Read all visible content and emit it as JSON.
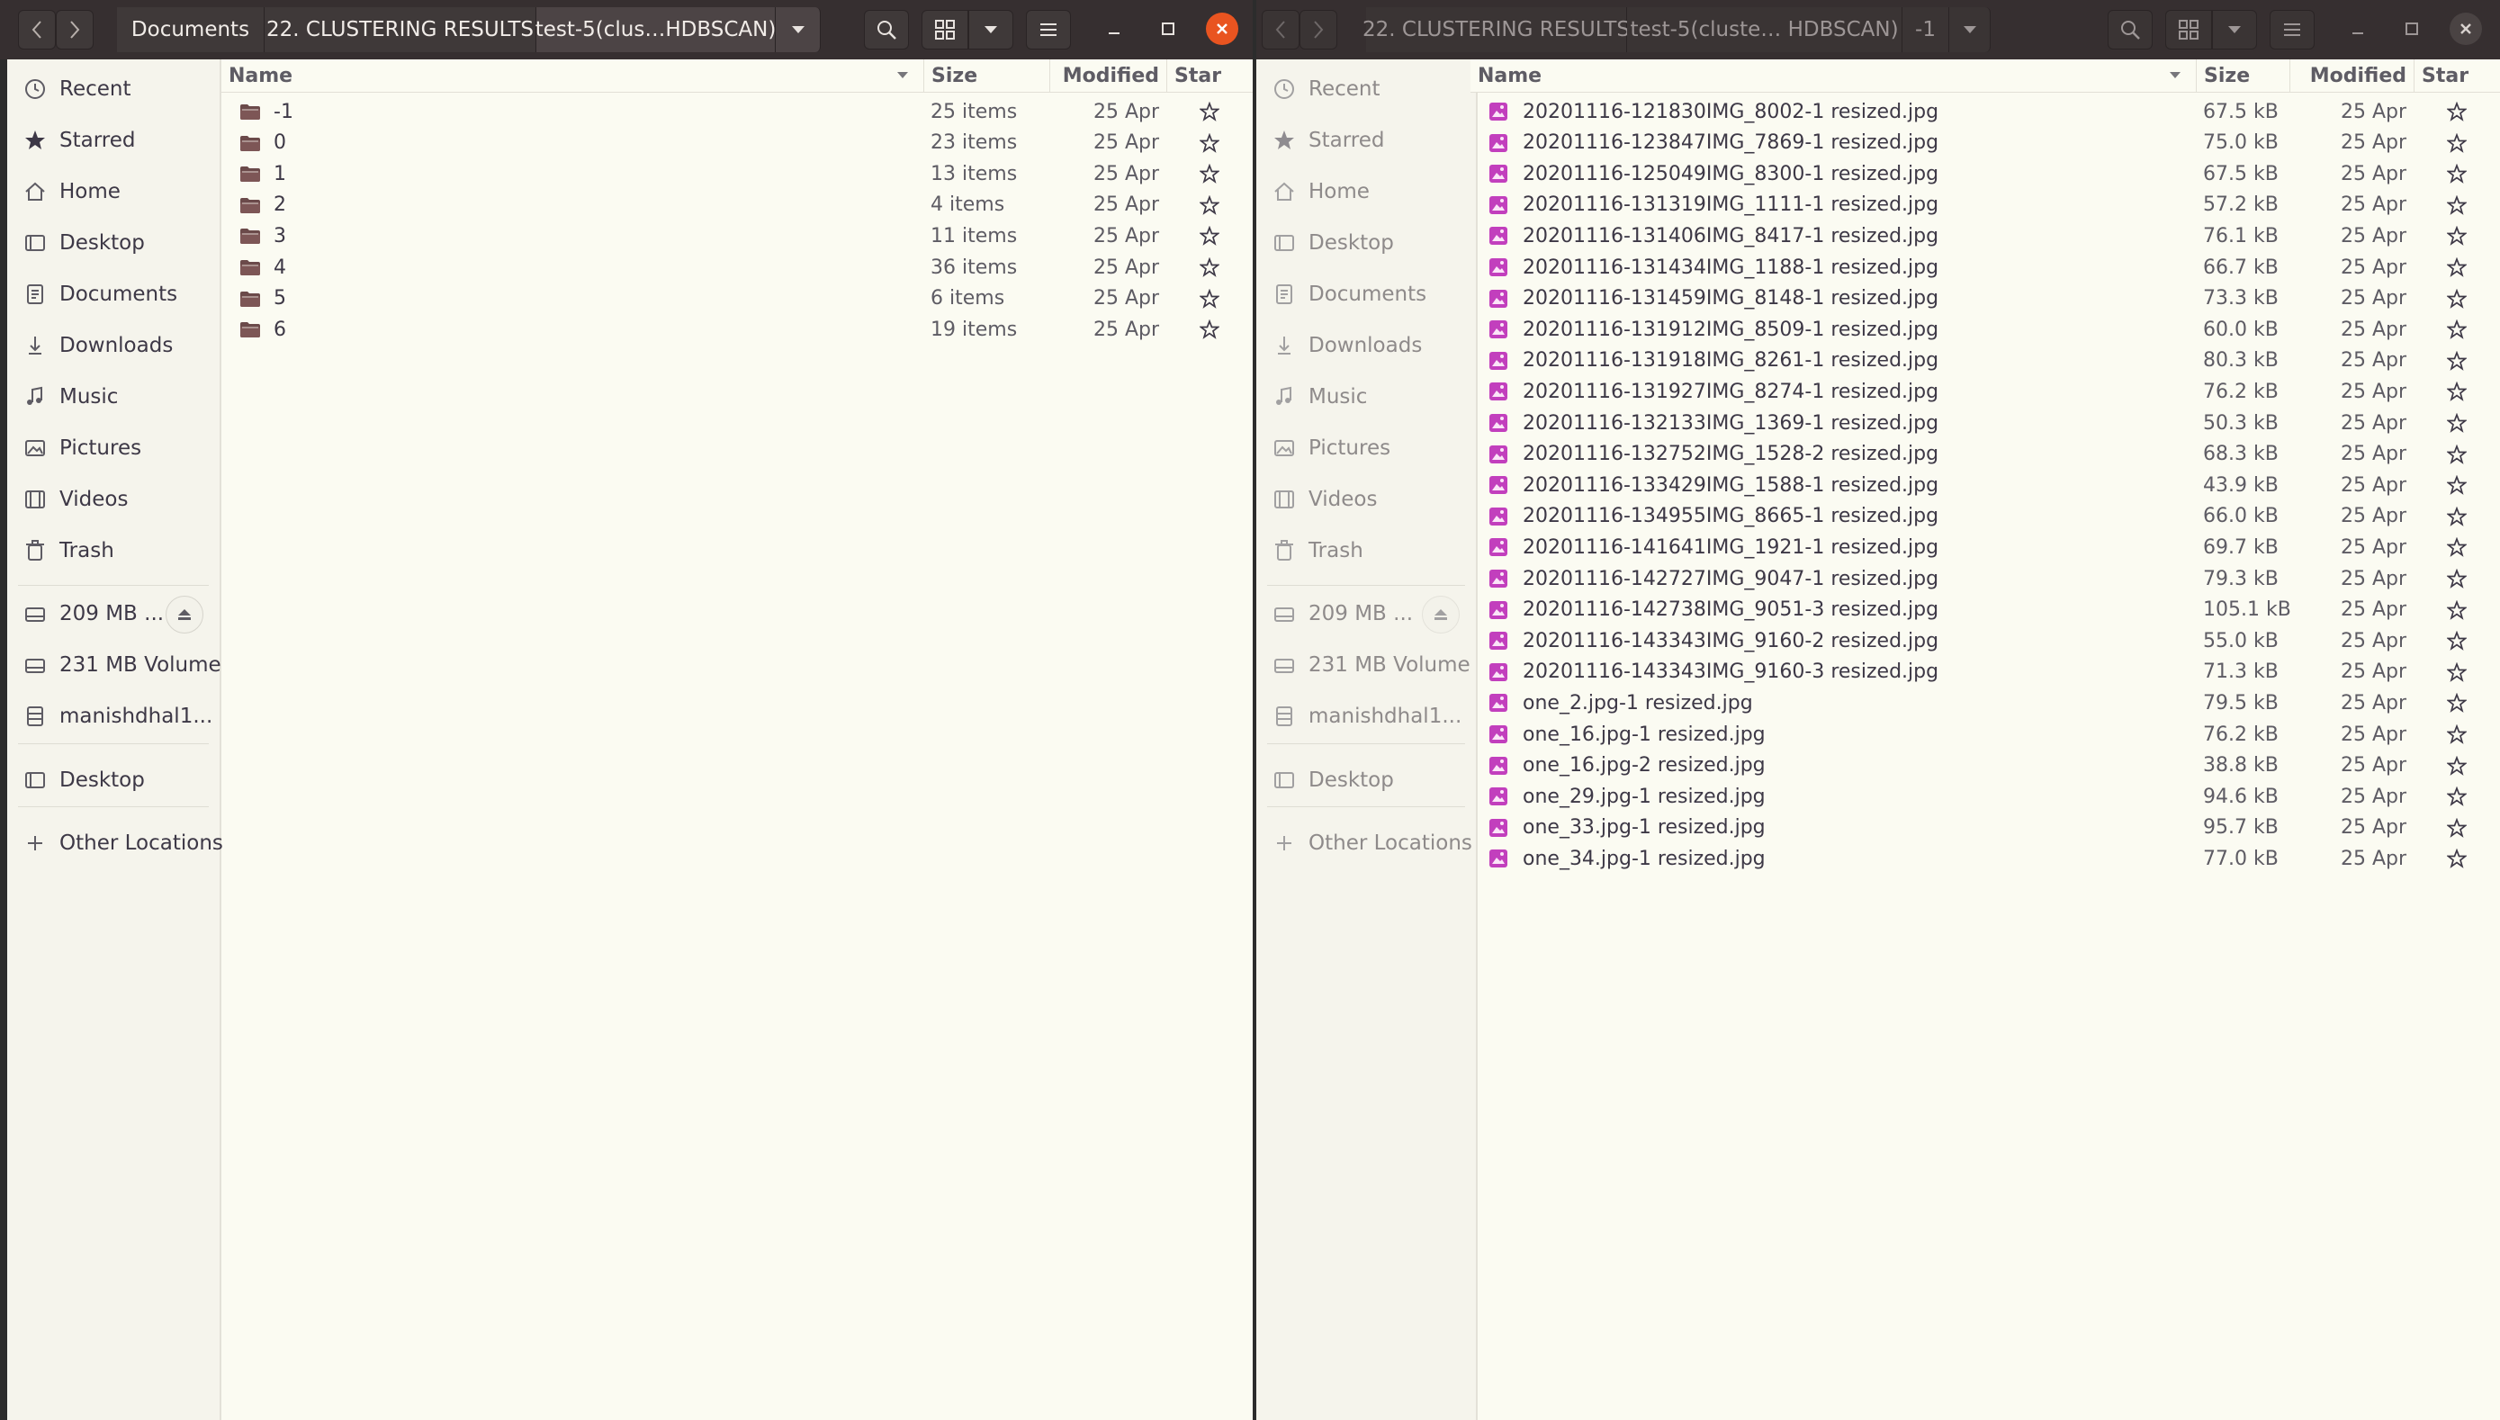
{
  "left": {
    "breadcrumbs": [
      "Documents",
      "22. CLUSTERING RESULTS",
      "test-5(clus…HDBSCAN)"
    ],
    "columns": {
      "name": "Name",
      "size": "Size",
      "modified": "Modified",
      "star": "Star"
    },
    "rows": [
      {
        "name": "-1",
        "size": "25 items",
        "modified": "25 Apr"
      },
      {
        "name": "0",
        "size": "23 items",
        "modified": "25 Apr"
      },
      {
        "name": "1",
        "size": "13 items",
        "modified": "25 Apr"
      },
      {
        "name": "2",
        "size": "4 items",
        "modified": "25 Apr"
      },
      {
        "name": "3",
        "size": "11 items",
        "modified": "25 Apr"
      },
      {
        "name": "4",
        "size": "36 items",
        "modified": "25 Apr"
      },
      {
        "name": "5",
        "size": "6 items",
        "modified": "25 Apr"
      },
      {
        "name": "6",
        "size": "19 items",
        "modified": "25 Apr"
      }
    ]
  },
  "right": {
    "breadcrumbs": [
      "22. CLUSTERING RESULTS",
      "test-5(cluste… HDBSCAN)",
      "-1"
    ],
    "columns": {
      "name": "Name",
      "size": "Size",
      "modified": "Modified",
      "star": "Star"
    },
    "rows": [
      {
        "name": "20201116-121830IMG_8002-1 resized.jpg",
        "size": "67.5 kB",
        "modified": "25 Apr"
      },
      {
        "name": "20201116-123847IMG_7869-1 resized.jpg",
        "size": "75.0 kB",
        "modified": "25 Apr"
      },
      {
        "name": "20201116-125049IMG_8300-1 resized.jpg",
        "size": "67.5 kB",
        "modified": "25 Apr"
      },
      {
        "name": "20201116-131319IMG_1111-1 resized.jpg",
        "size": "57.2 kB",
        "modified": "25 Apr"
      },
      {
        "name": "20201116-131406IMG_8417-1 resized.jpg",
        "size": "76.1 kB",
        "modified": "25 Apr"
      },
      {
        "name": "20201116-131434IMG_1188-1 resized.jpg",
        "size": "66.7 kB",
        "modified": "25 Apr"
      },
      {
        "name": "20201116-131459IMG_8148-1 resized.jpg",
        "size": "73.3 kB",
        "modified": "25 Apr"
      },
      {
        "name": "20201116-131912IMG_8509-1 resized.jpg",
        "size": "60.0 kB",
        "modified": "25 Apr"
      },
      {
        "name": "20201116-131918IMG_8261-1 resized.jpg",
        "size": "80.3 kB",
        "modified": "25 Apr"
      },
      {
        "name": "20201116-131927IMG_8274-1 resized.jpg",
        "size": "76.2 kB",
        "modified": "25 Apr"
      },
      {
        "name": "20201116-132133IMG_1369-1 resized.jpg",
        "size": "50.3 kB",
        "modified": "25 Apr"
      },
      {
        "name": "20201116-132752IMG_1528-2 resized.jpg",
        "size": "68.3 kB",
        "modified": "25 Apr"
      },
      {
        "name": "20201116-133429IMG_1588-1 resized.jpg",
        "size": "43.9 kB",
        "modified": "25 Apr"
      },
      {
        "name": "20201116-134955IMG_8665-1 resized.jpg",
        "size": "66.0 kB",
        "modified": "25 Apr"
      },
      {
        "name": "20201116-141641IMG_1921-1 resized.jpg",
        "size": "69.7 kB",
        "modified": "25 Apr"
      },
      {
        "name": "20201116-142727IMG_9047-1 resized.jpg",
        "size": "79.3 kB",
        "modified": "25 Apr"
      },
      {
        "name": "20201116-142738IMG_9051-3 resized.jpg",
        "size": "105.1 kB",
        "modified": "25 Apr"
      },
      {
        "name": "20201116-143343IMG_9160-2 resized.jpg",
        "size": "55.0 kB",
        "modified": "25 Apr"
      },
      {
        "name": "20201116-143343IMG_9160-3 resized.jpg",
        "size": "71.3 kB",
        "modified": "25 Apr"
      },
      {
        "name": "one_2.jpg-1 resized.jpg",
        "size": "79.5 kB",
        "modified": "25 Apr"
      },
      {
        "name": "one_16.jpg-1 resized.jpg",
        "size": "76.2 kB",
        "modified": "25 Apr"
      },
      {
        "name": "one_16.jpg-2 resized.jpg",
        "size": "38.8 kB",
        "modified": "25 Apr"
      },
      {
        "name": "one_29.jpg-1 resized.jpg",
        "size": "94.6 kB",
        "modified": "25 Apr"
      },
      {
        "name": "one_33.jpg-1 resized.jpg",
        "size": "95.7 kB",
        "modified": "25 Apr"
      },
      {
        "name": "one_34.jpg-1 resized.jpg",
        "size": "77.0 kB",
        "modified": "25 Apr"
      }
    ]
  },
  "sidebar": {
    "items": [
      {
        "label": "Recent",
        "icon": "clock-icon"
      },
      {
        "label": "Starred",
        "icon": "star-icon"
      },
      {
        "label": "Home",
        "icon": "home-icon"
      },
      {
        "label": "Desktop",
        "icon": "folder-icon"
      },
      {
        "label": "Documents",
        "icon": "document-icon"
      },
      {
        "label": "Downloads",
        "icon": "download-icon"
      },
      {
        "label": "Music",
        "icon": "music-icon"
      },
      {
        "label": "Pictures",
        "icon": "picture-icon"
      },
      {
        "label": "Videos",
        "icon": "video-icon"
      },
      {
        "label": "Trash",
        "icon": "trash-icon"
      }
    ],
    "devices": [
      {
        "label": "209 MB ...",
        "icon": "drive-icon",
        "eject": true
      },
      {
        "label": "231 MB Volume",
        "icon": "drive-icon"
      },
      {
        "label": "manishdhal1...",
        "icon": "server-icon"
      }
    ],
    "bookmarks": [
      {
        "label": "Desktop",
        "icon": "folder-icon"
      }
    ],
    "other": {
      "label": "Other Locations",
      "icon": "plus-icon"
    }
  },
  "colors": {
    "headerbar": "#362f30",
    "accent": "#e95420",
    "image_icon": "#c23fbd",
    "folder_icon": "#6b4a4a"
  }
}
